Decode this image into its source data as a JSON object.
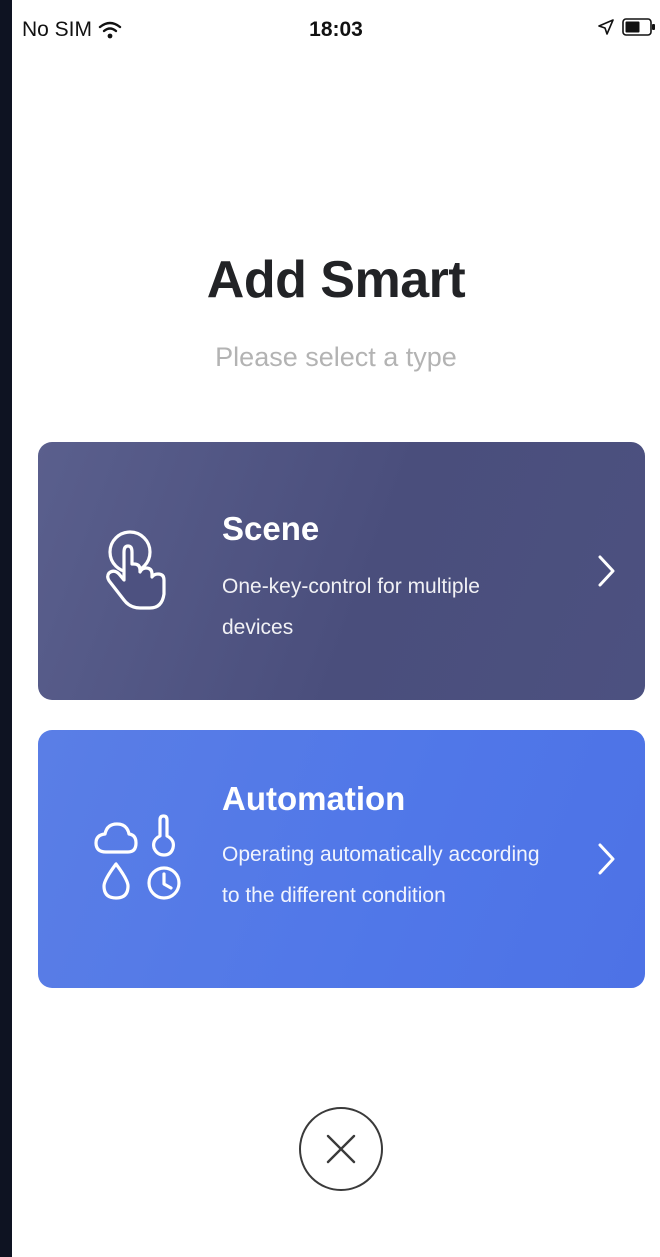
{
  "status_bar": {
    "carrier": "No SIM",
    "time": "18:03",
    "icons": [
      "wifi-icon",
      "location-arrow-icon",
      "battery-icon"
    ]
  },
  "header": {
    "title": "Add Smart",
    "subtitle": "Please select a type"
  },
  "cards": [
    {
      "title": "Scene",
      "description": "One-key-control for multiple devices",
      "icon": "tap-hand-icon",
      "color": "#4d5180"
    },
    {
      "title": "Automation",
      "description": "Operating automatically according to the different condition",
      "icon": "weather-conditions-icon",
      "color": "#5077e8"
    }
  ],
  "close": {
    "icon": "close-icon"
  },
  "colors": {
    "title_text": "#222326",
    "subtitle_text": "#b3b3b3",
    "scene_card": "#4d5180",
    "automation_card": "#5077e8"
  }
}
